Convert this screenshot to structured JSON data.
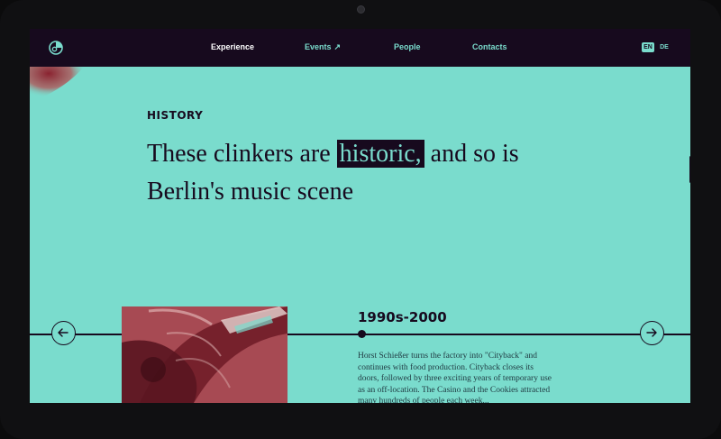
{
  "nav": {
    "experience": "Experience",
    "events": "Events",
    "people": "People",
    "contacts": "Contacts"
  },
  "lang": {
    "en": "EN",
    "de": "DE"
  },
  "history": {
    "label": "HISTORY",
    "headline_before": "These clinkers are",
    "headline_highlight": "historic,",
    "headline_after": "and so is Berlin's music scene"
  },
  "timeline": {
    "era": "1990s-2000",
    "description": "Horst Schießer turns the factory into \"Cityback\" and continues with food production. Cityback closes its doors, followed by three exciting years of temporary use as an off-location. The Casino and the Cookies attracted many hundreds of people each week..."
  },
  "icons": {
    "logo": "club-logo-icon",
    "events_link": "arrow-up-right-icon",
    "prev": "arrow-left-icon",
    "next": "arrow-right-icon"
  },
  "colors": {
    "background": "#7adccd",
    "dark": "#170a1e",
    "photo_tint": "#8a2330"
  }
}
